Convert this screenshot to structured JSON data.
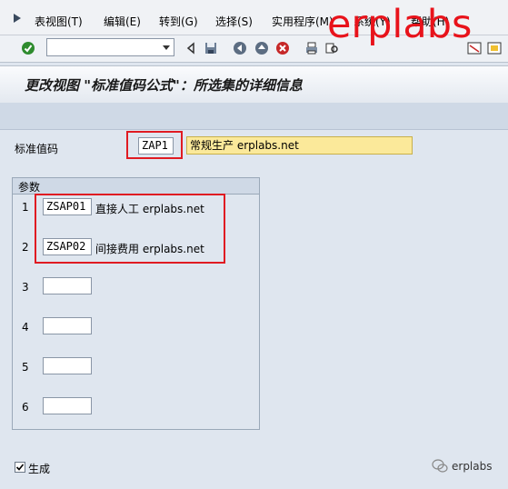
{
  "menu": [
    "表视图(T)",
    "编辑(E)",
    "转到(G)",
    "选择(S)",
    "实用程序(M)",
    "系统(Y)",
    "帮助(H)"
  ],
  "watermark_text": "erplabs",
  "page_title": "更改视图 \"标准值码公式\"：所选集的详细信息",
  "std_code": {
    "label": "标准值码",
    "value": "ZAP1",
    "description": "常规生产 erplabs.net"
  },
  "params": {
    "title": "参数",
    "rows": [
      {
        "num": "1",
        "code": "ZSAP01",
        "desc": "直接人工 erplabs.net"
      },
      {
        "num": "2",
        "code": "ZSAP02",
        "desc": "间接费用 erplabs.net"
      },
      {
        "num": "3",
        "code": "",
        "desc": ""
      },
      {
        "num": "4",
        "code": "",
        "desc": ""
      },
      {
        "num": "5",
        "code": "",
        "desc": ""
      },
      {
        "num": "6",
        "code": "",
        "desc": ""
      }
    ]
  },
  "generate": {
    "label": "生成",
    "checked": true
  },
  "footer_brand": "erplabs",
  "colors": {
    "highlight": "#e01b22",
    "desc_field": "#fbe99a",
    "background": "#dfe6ef"
  },
  "icons": [
    "enter-icon",
    "back-icon",
    "save-icon",
    "exit-icon",
    "cancel-icon",
    "print-icon",
    "find-icon",
    "wechat-icon"
  ]
}
